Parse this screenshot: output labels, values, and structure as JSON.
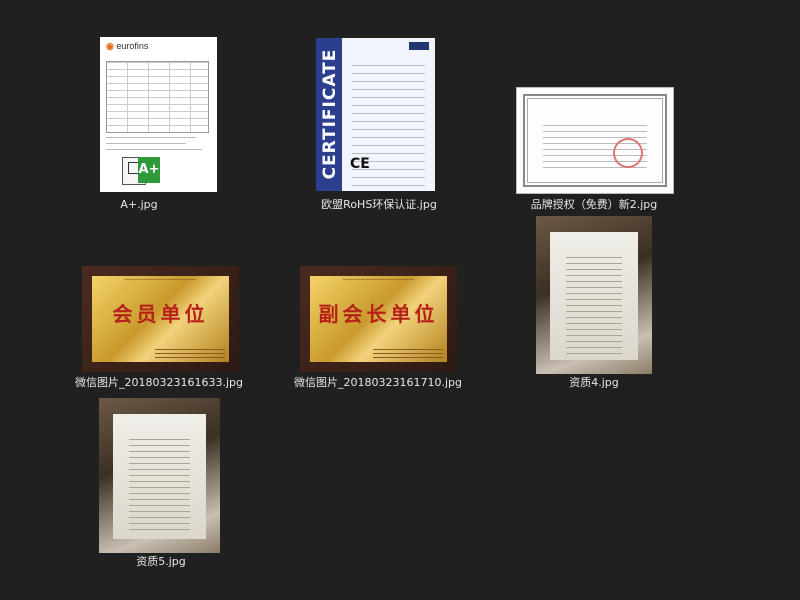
{
  "files": [
    {
      "name": "A+.jpg",
      "thumb_text": "eurofins",
      "thumb_badge": "A+"
    },
    {
      "name": "欧盟RoHS环保认证.jpg",
      "thumb_text": "CERTIFICATE"
    },
    {
      "name": "品牌授权（免费）新2.jpg"
    },
    {
      "name": "微信图片_20180323161633.jpg",
      "thumb_text": "会员单位"
    },
    {
      "name": "微信图片_20180323161710.jpg",
      "thumb_text": "副会长单位"
    },
    {
      "name": "资质4.jpg"
    },
    {
      "name": "资质5.jpg"
    }
  ],
  "colors": {
    "background": "#202020",
    "caption": "#e6e6e6"
  }
}
